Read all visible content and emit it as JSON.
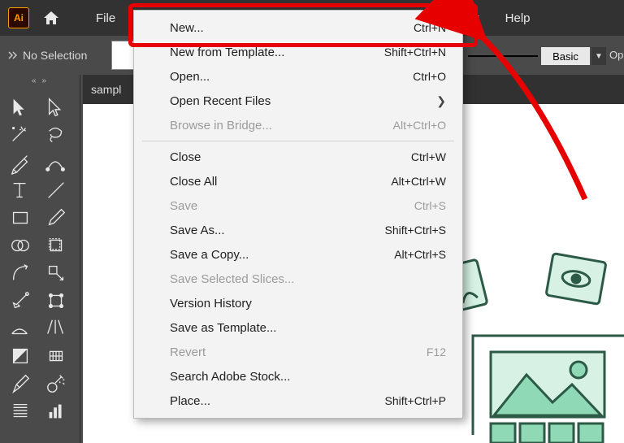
{
  "app": {
    "badge": "Ai"
  },
  "menubar": {
    "file": "File",
    "view_last_letter": "v",
    "help": "Help"
  },
  "ctrlbar": {
    "no_selection": "No Selection",
    "stroke_style": "Basic",
    "opacity_label": "Opa"
  },
  "document": {
    "tab_name": "sampl"
  },
  "dropdown": {
    "rows": [
      {
        "label": "New...",
        "shortcut": "Ctrl+N",
        "disabled": false
      },
      {
        "label": "New from Template...",
        "shortcut": "Shift+Ctrl+N",
        "disabled": false
      },
      {
        "label": "Open...",
        "shortcut": "Ctrl+O",
        "disabled": false
      },
      {
        "label": "Open Recent Files",
        "shortcut": "",
        "submenu": true,
        "disabled": false
      },
      {
        "label": "Browse in Bridge...",
        "shortcut": "Alt+Ctrl+O",
        "disabled": true
      },
      {
        "sep": true
      },
      {
        "label": "Close",
        "shortcut": "Ctrl+W",
        "disabled": false
      },
      {
        "label": "Close All",
        "shortcut": "Alt+Ctrl+W",
        "disabled": false
      },
      {
        "label": "Save",
        "shortcut": "Ctrl+S",
        "disabled": true
      },
      {
        "label": "Save As...",
        "shortcut": "Shift+Ctrl+S",
        "disabled": false
      },
      {
        "label": "Save a Copy...",
        "shortcut": "Alt+Ctrl+S",
        "disabled": false
      },
      {
        "label": "Save Selected Slices...",
        "shortcut": "",
        "disabled": true
      },
      {
        "label": "Version History",
        "shortcut": "",
        "disabled": false
      },
      {
        "label": "Save as Template...",
        "shortcut": "",
        "disabled": false
      },
      {
        "label": "Revert",
        "shortcut": "F12",
        "disabled": true
      },
      {
        "label": "Search Adobe Stock...",
        "shortcut": "",
        "disabled": false
      },
      {
        "label": "Place...",
        "shortcut": "Shift+Ctrl+P",
        "disabled": false
      }
    ]
  },
  "tools": [
    "selection",
    "direct-selection",
    "magic-wand",
    "lasso",
    "pen",
    "curvature",
    "type",
    "line",
    "rectangle",
    "paintbrush",
    "shape-builder",
    "rotate",
    "scale",
    "free-transform",
    "width",
    "warp",
    "mesh",
    "perspective",
    "gradient",
    "eyedropper",
    "blend",
    "symbol-sprayer",
    "wrinkle",
    "column-graph"
  ],
  "colors": {
    "annotation": "#e70000",
    "art_green": "#8fd9b6",
    "art_dark": "#2c5a47"
  }
}
